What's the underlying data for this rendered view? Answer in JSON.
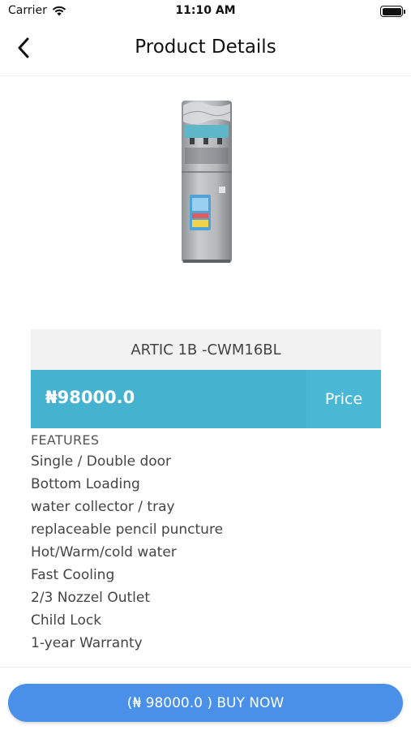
{
  "status_bar": {
    "carrier": "Carrier",
    "time": "11:10 AM",
    "battery_level": 1.0
  },
  "nav": {
    "title": "Product Details",
    "back_icon": "chevron-left-icon"
  },
  "product": {
    "image_icon": "water-dispenser-image",
    "name": "ARTIC 1B -CWM16BL",
    "price": "₦98000.0",
    "price_label": "Price"
  },
  "features": {
    "heading": "FEATURES",
    "items": [
      "Single / Double door",
      "Bottom Loading",
      "water collector / tray",
      "replaceable pencil puncture",
      "Hot/Warm/cold water",
      "Fast Cooling",
      "2/3 Nozzel Outlet",
      "Child Lock",
      "1-year Warranty"
    ]
  },
  "buy_button": {
    "label": "(₦ 98000.0 ) BUY NOW"
  },
  "colors": {
    "price_bar": "#45b3cf",
    "buy_button": "#4a90e8"
  }
}
